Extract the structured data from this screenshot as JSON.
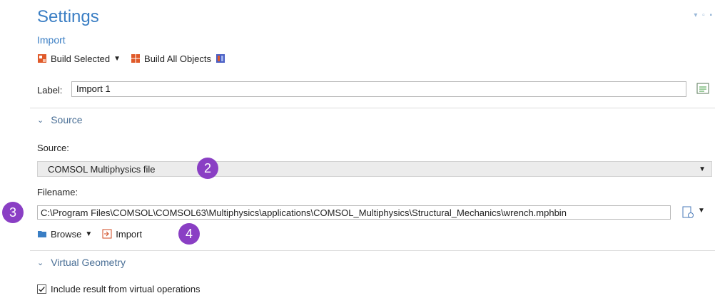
{
  "header": {
    "title": "Settings",
    "subtitle": "Import"
  },
  "toolbar": {
    "build_selected": "Build Selected",
    "build_all": "Build All Objects"
  },
  "label_field": {
    "label": "Label:",
    "value": "Import 1"
  },
  "source_section": {
    "title": "Source",
    "source_label": "Source:",
    "source_value": "COMSOL Multiphysics file",
    "filename_label": "Filename:",
    "filename_value": "C:\\Program Files\\COMSOL\\COMSOL63\\Multiphysics\\applications\\COMSOL_Multiphysics\\Structural_Mechanics\\wrench.mphbin",
    "browse_label": "Browse",
    "import_label": "Import"
  },
  "virtual_section": {
    "title": "Virtual Geometry",
    "include_label": "Include result from virtual operations",
    "include_checked": true
  },
  "badges": {
    "b2": "2",
    "b3": "3",
    "b4": "4"
  },
  "colors": {
    "accent": "#3a7ec4",
    "badge": "#8a3fc4"
  }
}
